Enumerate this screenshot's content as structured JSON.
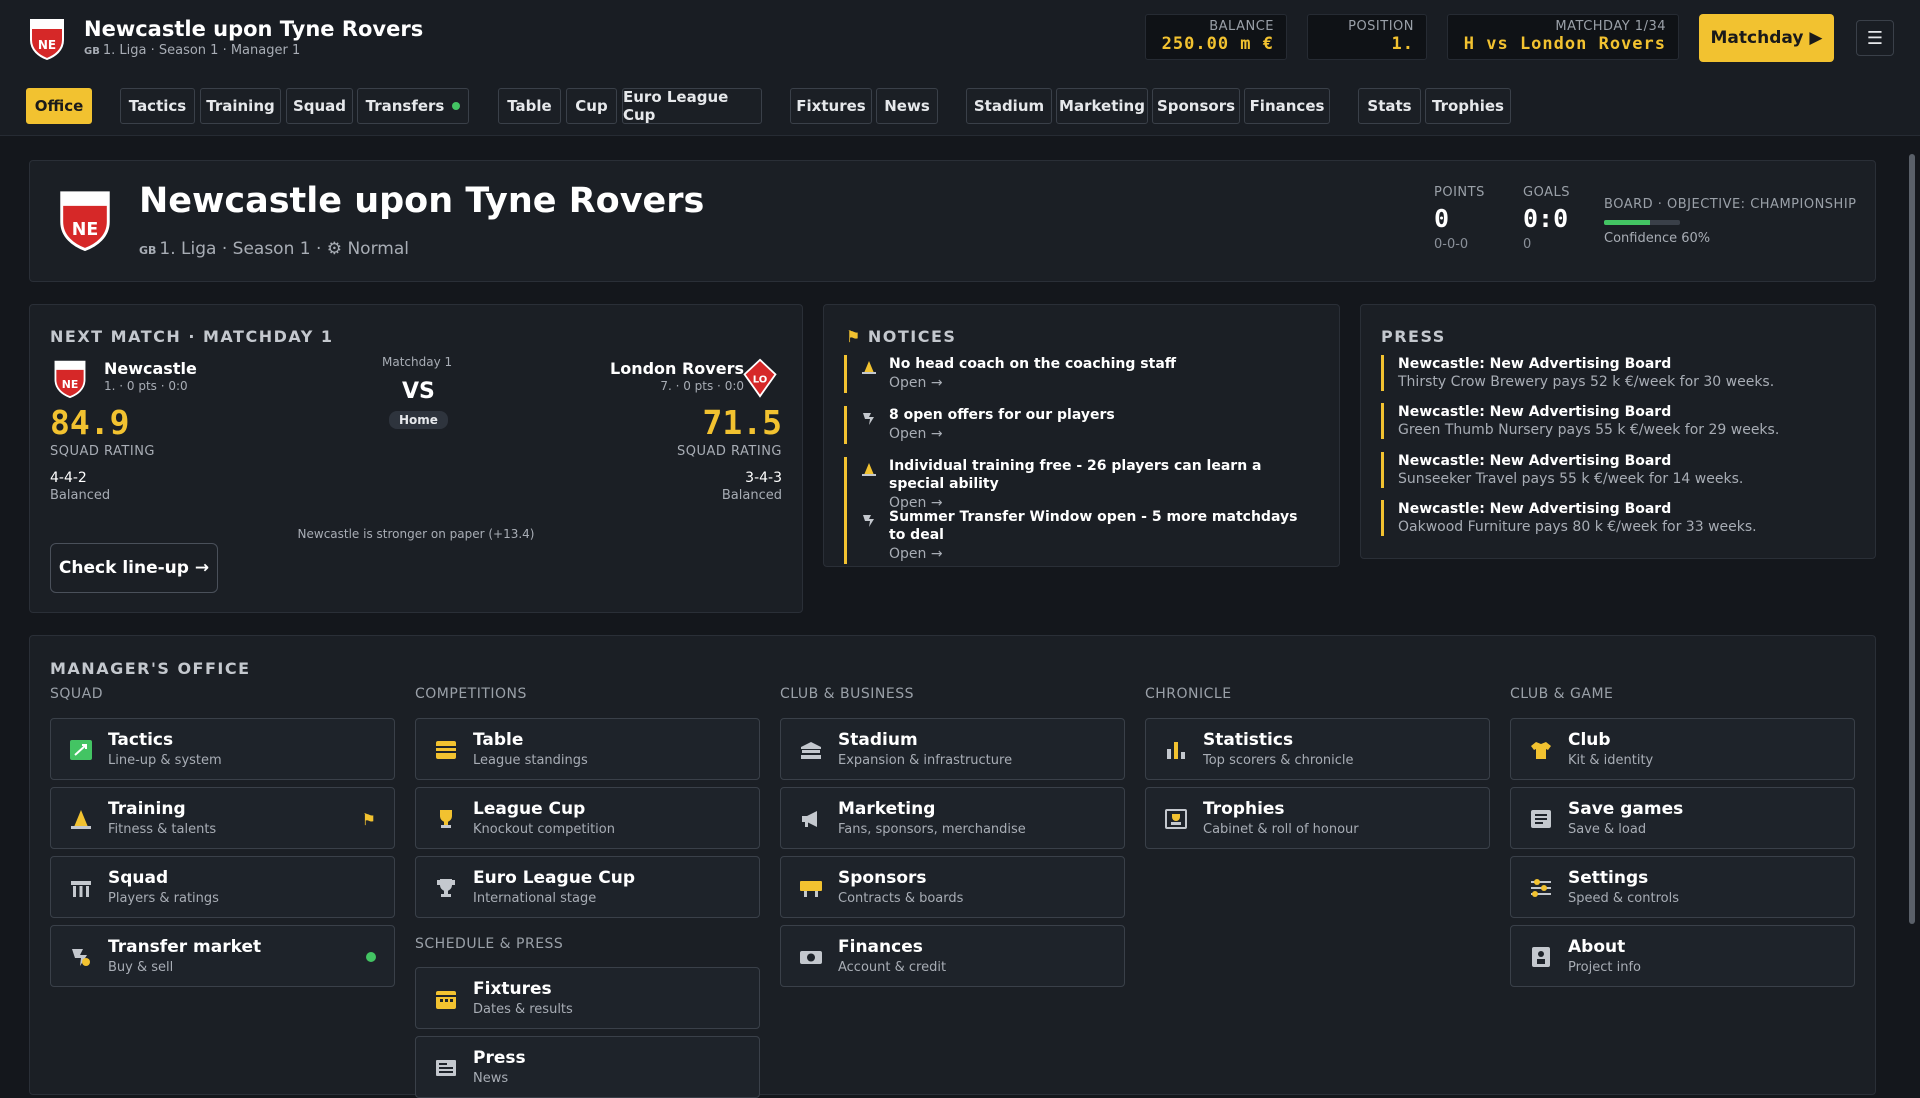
{
  "header": {
    "club_name": "Newcastle upon Tyne Rovers",
    "country_code": "GB",
    "sub": "1. Liga · Season 1 · Manager 1",
    "crest_text": "NE",
    "balance_label": "BALANCE",
    "balance": "250.00 m €",
    "position_label": "POSITION",
    "position": "1.",
    "matchday_label": "MATCHDAY 1/34",
    "fixture": "H vs London Rovers",
    "matchday_button": "Matchday",
    "menu_icon": "hamburger-icon"
  },
  "nav": [
    "Office",
    "Tactics",
    "Training",
    "Squad",
    "Transfers",
    "Table",
    "Cup",
    "Euro League Cup",
    "Fixtures",
    "News",
    "Stadium",
    "Marketing",
    "Sponsors",
    "Finances",
    "Stats",
    "Trophies"
  ],
  "hero": {
    "title": "Newcastle upon Tyne Rovers",
    "country_code": "GB",
    "meta": "1. Liga · Season 1 ·",
    "difficulty": "Normal",
    "points_label": "POINTS",
    "points": "0",
    "points_sub": "0-0-0",
    "goals_label": "GOALS",
    "goals": "0:0",
    "goals_sub": "0",
    "board_label": "BOARD · OBJECTIVE: CHAMPIONSHIP",
    "confidence": "Confidence 60%",
    "confidence_value": 0.6
  },
  "next_match": {
    "heading": "NEXT MATCH · MATCHDAY 1",
    "matchday": "Matchday 1",
    "vs": "VS",
    "venue": "Home",
    "home": {
      "name": "Newcastle",
      "info": "1. · 0 pts · 0:0",
      "rating": "84.9",
      "rating_label": "SQUAD RATING",
      "formation": "4-4-2",
      "style": "Balanced",
      "crest": "NE"
    },
    "away": {
      "name": "London Rovers",
      "info": "7. · 0 pts · 0:0",
      "rating": "71.5",
      "rating_label": "SQUAD RATING",
      "formation": "3-4-3",
      "style": "Balanced",
      "crest": "LO"
    },
    "comparison": "Newcastle is stronger on paper (+13.4)",
    "lineup_button": "Check line-up →"
  },
  "notices": {
    "heading": "NOTICES",
    "items": [
      {
        "title": "No head coach on the coaching staff",
        "link": "Open →",
        "icon": "cone-icon"
      },
      {
        "title": "8 open offers for our players",
        "link": "Open →",
        "icon": "transfer-icon"
      },
      {
        "title": "Individual training free - 26 players can learn a special ability",
        "link": "Open →",
        "icon": "cone-icon"
      },
      {
        "title": "Summer Transfer Window open - 5 more matchdays to deal",
        "link": "Open →",
        "icon": "transfer-icon"
      }
    ]
  },
  "press": {
    "heading": "PRESS",
    "items": [
      {
        "title": "Newcastle: New Advertising Board",
        "desc": "Thirsty Crow Brewery pays 52 k €/week for 30 weeks."
      },
      {
        "title": "Newcastle: New Advertising Board",
        "desc": "Green Thumb Nursery pays 55 k €/week for 29 weeks."
      },
      {
        "title": "Newcastle: New Advertising Board",
        "desc": "Sunseeker Travel pays 55 k €/week for 14 weeks."
      },
      {
        "title": "Newcastle: New Advertising Board",
        "desc": "Oakwood Furniture pays 80 k €/week for 33 weeks."
      }
    ]
  },
  "office": {
    "heading": "MANAGER'S OFFICE",
    "cols": [
      "SQUAD",
      "COMPETITIONS",
      "CLUB & BUSINESS",
      "CHRONICLE",
      "CLUB & GAME"
    ],
    "schedule_heading": "SCHEDULE & PRESS",
    "cards": {
      "tactics": {
        "t": "Tactics",
        "s": "Line-up & system"
      },
      "training": {
        "t": "Training",
        "s": "Fitness & talents"
      },
      "squad": {
        "t": "Squad",
        "s": "Players & ratings"
      },
      "transfer": {
        "t": "Transfer market",
        "s": "Buy & sell"
      },
      "table": {
        "t": "Table",
        "s": "League standings"
      },
      "leaguecup": {
        "t": "League Cup",
        "s": "Knockout competition"
      },
      "euro": {
        "t": "Euro League Cup",
        "s": "International stage"
      },
      "fixtures": {
        "t": "Fixtures",
        "s": "Dates & results"
      },
      "press": {
        "t": "Press",
        "s": "News"
      },
      "stadium": {
        "t": "Stadium",
        "s": "Expansion & infrastructure"
      },
      "marketing": {
        "t": "Marketing",
        "s": "Fans, sponsors, merchandise"
      },
      "sponsors": {
        "t": "Sponsors",
        "s": "Contracts & boards"
      },
      "finances": {
        "t": "Finances",
        "s": "Account & credit"
      },
      "statistics": {
        "t": "Statistics",
        "s": "Top scorers & chronicle"
      },
      "trophies": {
        "t": "Trophies",
        "s": "Cabinet & roll of honour"
      },
      "club": {
        "t": "Club",
        "s": "Kit & identity"
      },
      "save": {
        "t": "Save games",
        "s": "Save & load"
      },
      "settings": {
        "t": "Settings",
        "s": "Speed & controls"
      },
      "about": {
        "t": "About",
        "s": "Project info"
      }
    }
  },
  "colors": {
    "accent": "#f2c230",
    "green": "#43c463",
    "crest_red": "#d62828"
  }
}
